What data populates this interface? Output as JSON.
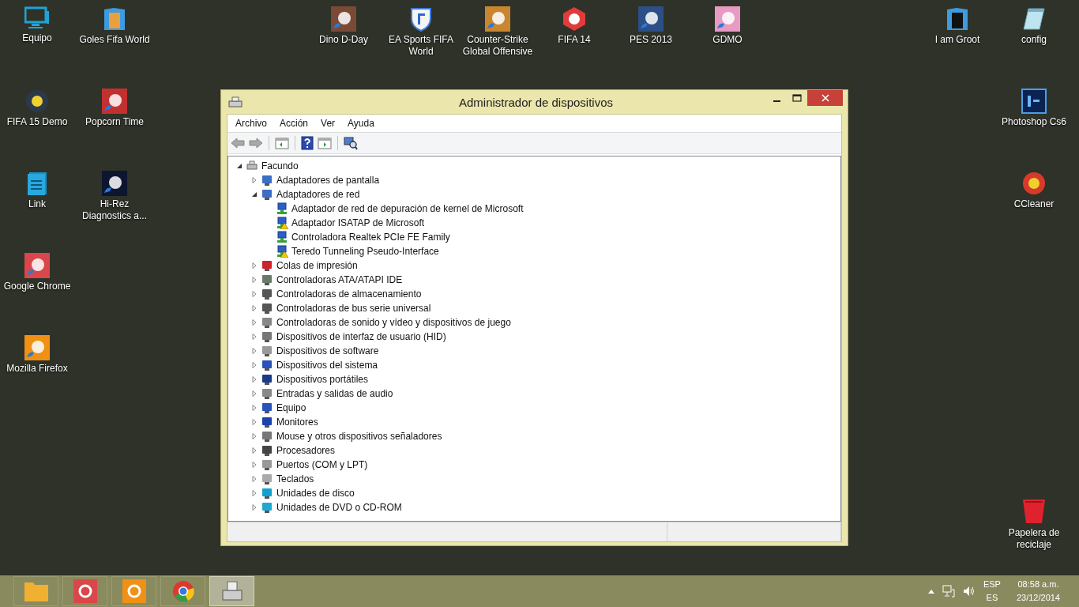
{
  "desktop": {
    "icons": [
      {
        "label": "Equipo"
      },
      {
        "label": "Goles Fifa World"
      },
      {
        "label": "Dino D-Day"
      },
      {
        "label": "EA Sports FIFA World"
      },
      {
        "label": "Counter-Strike Global Offensive"
      },
      {
        "label": "FIFA 14"
      },
      {
        "label": "PES 2013"
      },
      {
        "label": "GDMO"
      },
      {
        "label": "I am Groot"
      },
      {
        "label": "config"
      },
      {
        "label": "FIFA 15 Demo"
      },
      {
        "label": "Popcorn Time"
      },
      {
        "label": "Photoshop Cs6"
      },
      {
        "label": "Link"
      },
      {
        "label": "Hi-Rez Diagnostics a..."
      },
      {
        "label": "CCleaner"
      },
      {
        "label": "Google Chrome"
      },
      {
        "label": "Mozilla Firefox"
      },
      {
        "label": "Papelera de reciclaje"
      }
    ]
  },
  "window": {
    "title": "Administrador de dispositivos",
    "menu": [
      "Archivo",
      "Acción",
      "Ver",
      "Ayuda"
    ],
    "tree": {
      "label": "Facundo",
      "expanded": true,
      "children": [
        {
          "label": "Adaptadores de pantalla",
          "expanded": false
        },
        {
          "label": "Adaptadores de red",
          "expanded": true,
          "children": [
            {
              "label": "Adaptador de red de depuración de kernel de Microsoft",
              "warning": false
            },
            {
              "label": "Adaptador ISATAP de Microsoft",
              "warning": true
            },
            {
              "label": "Controladora Realtek PCIe FE Family",
              "warning": false
            },
            {
              "label": "Teredo Tunneling Pseudo-Interface",
              "warning": true
            }
          ]
        },
        {
          "label": "Colas de impresión",
          "expanded": false
        },
        {
          "label": "Controladoras ATA/ATAPI IDE",
          "expanded": false
        },
        {
          "label": "Controladoras de almacenamiento",
          "expanded": false
        },
        {
          "label": "Controladoras de bus serie universal",
          "expanded": false
        },
        {
          "label": "Controladoras de sonido y vídeo y dispositivos de juego",
          "expanded": false
        },
        {
          "label": "Dispositivos de interfaz de usuario (HID)",
          "expanded": false
        },
        {
          "label": "Dispositivos de software",
          "expanded": false
        },
        {
          "label": "Dispositivos del sistema",
          "expanded": false
        },
        {
          "label": "Dispositivos portátiles",
          "expanded": false
        },
        {
          "label": "Entradas y salidas de audio",
          "expanded": false
        },
        {
          "label": "Equipo",
          "expanded": false
        },
        {
          "label": "Monitores",
          "expanded": false
        },
        {
          "label": "Mouse y otros dispositivos señaladores",
          "expanded": false
        },
        {
          "label": "Procesadores",
          "expanded": false
        },
        {
          "label": "Puertos (COM y LPT)",
          "expanded": false
        },
        {
          "label": "Teclados",
          "expanded": false
        },
        {
          "label": "Unidades de disco",
          "expanded": false
        },
        {
          "label": "Unidades de DVD o CD-ROM",
          "expanded": false
        }
      ]
    }
  },
  "taskbar": {
    "buttons": [
      {
        "selected": false
      },
      {
        "selected": false
      },
      {
        "selected": false
      },
      {
        "selected": false
      },
      {
        "selected": true
      }
    ],
    "language": "ESP",
    "keyboard": "ES",
    "time": "08:58 a.m.",
    "date": "23/12/2014"
  }
}
